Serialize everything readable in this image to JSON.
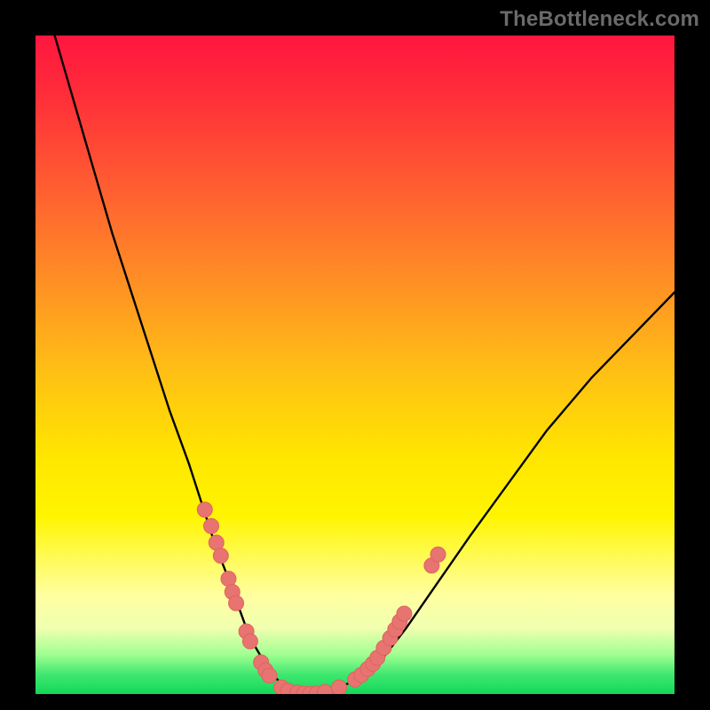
{
  "caption": "TheBottleneck.com",
  "colors": {
    "frame": "#000000",
    "curve_stroke": "#000000",
    "marker_fill": "#e77470",
    "marker_stroke": "#e0635f",
    "gradient_top": "#ff163f",
    "gradient_bottom": "#12d85a"
  },
  "chart_data": {
    "type": "line",
    "title": "",
    "xlabel": "",
    "ylabel": "",
    "xlim": [
      0,
      100
    ],
    "ylim": [
      0,
      100
    ],
    "grid": false,
    "legend": false,
    "series": [
      {
        "name": "bottleneck-curve",
        "x": [
          0,
          3,
          6,
          9,
          12,
          15,
          18,
          21,
          24,
          26,
          28,
          30,
          31.5,
          33,
          34.5,
          36,
          37.5,
          39,
          41,
          43,
          46,
          50,
          54,
          58,
          63,
          68,
          74,
          80,
          87,
          94,
          100
        ],
        "y": [
          110,
          100,
          90,
          80,
          70,
          61,
          52,
          43,
          35,
          29,
          23,
          18,
          14,
          10,
          7,
          4.5,
          2.5,
          1.2,
          0.3,
          0,
          0.5,
          2,
          5,
          10,
          17,
          24,
          32,
          40,
          48,
          55,
          61
        ]
      }
    ],
    "markers": {
      "name": "highlight-dots",
      "points": [
        {
          "x": 26.5,
          "y": 28
        },
        {
          "x": 27.5,
          "y": 25.5
        },
        {
          "x": 28.3,
          "y": 23
        },
        {
          "x": 29.0,
          "y": 21
        },
        {
          "x": 30.2,
          "y": 17.5
        },
        {
          "x": 30.8,
          "y": 15.5
        },
        {
          "x": 31.4,
          "y": 13.8
        },
        {
          "x": 33.0,
          "y": 9.5
        },
        {
          "x": 33.6,
          "y": 8.0
        },
        {
          "x": 35.3,
          "y": 4.8
        },
        {
          "x": 36.0,
          "y": 3.6
        },
        {
          "x": 36.6,
          "y": 2.8
        },
        {
          "x": 38.5,
          "y": 1.0
        },
        {
          "x": 39.5,
          "y": 0.5
        },
        {
          "x": 41.0,
          "y": 0.2
        },
        {
          "x": 42.0,
          "y": 0.05
        },
        {
          "x": 43.0,
          "y": 0.0
        },
        {
          "x": 44.0,
          "y": 0.05
        },
        {
          "x": 45.3,
          "y": 0.3
        },
        {
          "x": 47.5,
          "y": 1.0
        },
        {
          "x": 50.0,
          "y": 2.2
        },
        {
          "x": 51.0,
          "y": 2.9
        },
        {
          "x": 52.0,
          "y": 3.8
        },
        {
          "x": 52.8,
          "y": 4.6
        },
        {
          "x": 53.5,
          "y": 5.5
        },
        {
          "x": 54.5,
          "y": 7.0
        },
        {
          "x": 55.5,
          "y": 8.5
        },
        {
          "x": 56.3,
          "y": 9.8
        },
        {
          "x": 57.0,
          "y": 11.0
        },
        {
          "x": 57.7,
          "y": 12.2
        },
        {
          "x": 62.0,
          "y": 19.5
        },
        {
          "x": 63.0,
          "y": 21.2
        }
      ]
    }
  }
}
